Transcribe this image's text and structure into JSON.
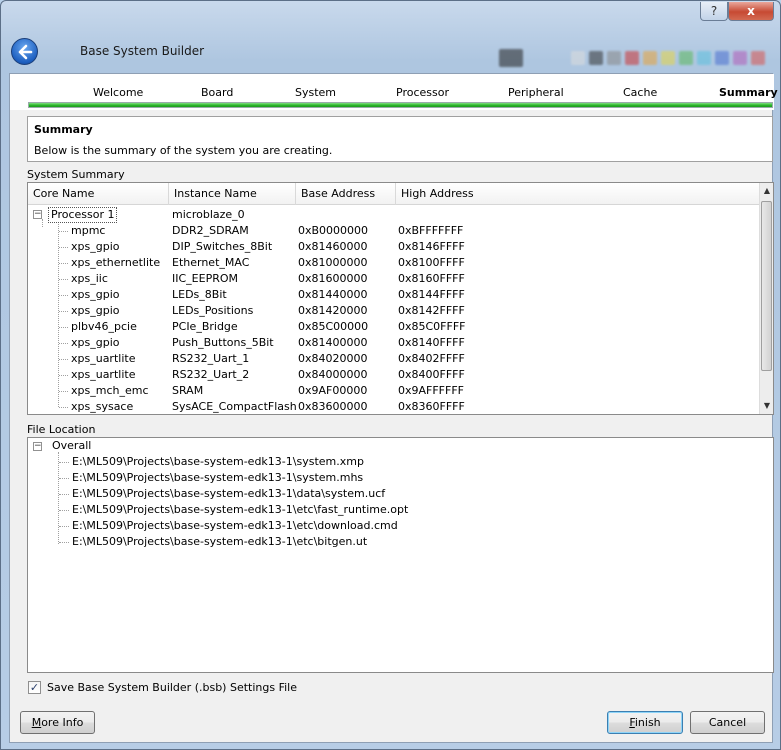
{
  "window": {
    "title": "Base System Builder",
    "help_glyph": "?",
    "close_glyph": "x"
  },
  "steps": {
    "items": [
      {
        "label": "Welcome"
      },
      {
        "label": "Board"
      },
      {
        "label": "System"
      },
      {
        "label": "Processor"
      },
      {
        "label": "Peripheral"
      },
      {
        "label": "Cache"
      },
      {
        "label": "Summary",
        "active": true
      }
    ],
    "progress": 1.0
  },
  "summary": {
    "title": "Summary",
    "description": "Below is the summary of the system you are creating."
  },
  "system_summary": {
    "group_label": "System Summary",
    "columns": [
      "Core Name",
      "Instance Name",
      "Base Address",
      "High Address"
    ],
    "parent": {
      "core": "Processor 1",
      "instance": "microblaze_0"
    },
    "rows": [
      {
        "core": "mpmc",
        "instance": "DDR2_SDRAM",
        "base": "0xB0000000",
        "high": "0xBFFFFFFF"
      },
      {
        "core": "xps_gpio",
        "instance": "DIP_Switches_8Bit",
        "base": "0x81460000",
        "high": "0x8146FFFF"
      },
      {
        "core": "xps_ethernetlite",
        "instance": "Ethernet_MAC",
        "base": "0x81000000",
        "high": "0x8100FFFF"
      },
      {
        "core": "xps_iic",
        "instance": "IIC_EEPROM",
        "base": "0x81600000",
        "high": "0x8160FFFF"
      },
      {
        "core": "xps_gpio",
        "instance": "LEDs_8Bit",
        "base": "0x81440000",
        "high": "0x8144FFFF"
      },
      {
        "core": "xps_gpio",
        "instance": "LEDs_Positions",
        "base": "0x81420000",
        "high": "0x8142FFFF"
      },
      {
        "core": "plbv46_pcie",
        "instance": "PCIe_Bridge",
        "base": "0x85C00000",
        "high": "0x85C0FFFF"
      },
      {
        "core": "xps_gpio",
        "instance": "Push_Buttons_5Bit",
        "base": "0x81400000",
        "high": "0x8140FFFF"
      },
      {
        "core": "xps_uartlite",
        "instance": "RS232_Uart_1",
        "base": "0x84020000",
        "high": "0x8402FFFF"
      },
      {
        "core": "xps_uartlite",
        "instance": "RS232_Uart_2",
        "base": "0x84000000",
        "high": "0x8400FFFF"
      },
      {
        "core": "xps_mch_emc",
        "instance": "SRAM",
        "base": "0x9AF00000",
        "high": "0x9AFFFFFF"
      },
      {
        "core": "xps_sysace",
        "instance": "SysACE_CompactFlash",
        "base": "0x83600000",
        "high": "0x8360FFFF"
      }
    ]
  },
  "file_location": {
    "group_label": "File Location",
    "root": "Overall",
    "files": [
      "E:\\ML509\\Projects\\base-system-edk13-1\\system.xmp",
      "E:\\ML509\\Projects\\base-system-edk13-1\\system.mhs",
      "E:\\ML509\\Projects\\base-system-edk13-1\\data\\system.ucf",
      "E:\\ML509\\Projects\\base-system-edk13-1\\etc\\fast_runtime.opt",
      "E:\\ML509\\Projects\\base-system-edk13-1\\etc\\download.cmd",
      "E:\\ML509\\Projects\\base-system-edk13-1\\etc\\bitgen.ut"
    ]
  },
  "save_settings": {
    "label": "Save Base System Builder (.bsb) Settings File",
    "checked": true,
    "check_glyph": "✓"
  },
  "buttons": {
    "more_info": {
      "first": "M",
      "rest": "ore Info"
    },
    "finish": {
      "first": "F",
      "rest": "inish"
    },
    "cancel": "Cancel"
  },
  "tree_glyphs": {
    "expanded": "−"
  },
  "icons": {
    "back": "back-arrow-icon",
    "scroll_up": "▲",
    "scroll_down": "▼"
  }
}
